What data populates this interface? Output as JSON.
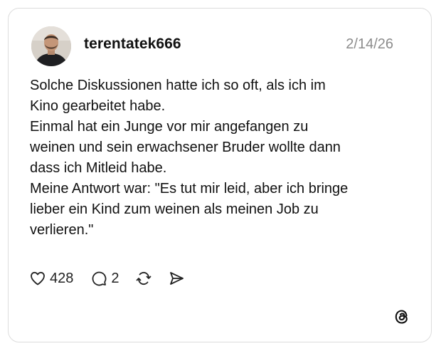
{
  "post": {
    "username": "terentatek666",
    "date": "2/14/26",
    "lines": [
      "Solche Diskussionen hatte ich so oft, als ich im",
      "Kino gearbeitet habe.",
      "Einmal hat ein Junge vor mir angefangen zu",
      "weinen und sein erwachsener Bruder wollte dann",
      "dass ich Mitleid habe.",
      "Meine Antwort war: \"Es tut mir leid, aber ich bringe",
      "lieber ein Kind zum weinen als meinen Job zu",
      "verlieren.\""
    ]
  },
  "actions": {
    "like_count": "428",
    "reply_count": "2",
    "like_icon": "heart-icon",
    "reply_icon": "comment-icon",
    "repost_icon": "repost-icon",
    "share_icon": "send-icon"
  },
  "brand": {
    "logo_icon": "threads-logo-icon"
  }
}
